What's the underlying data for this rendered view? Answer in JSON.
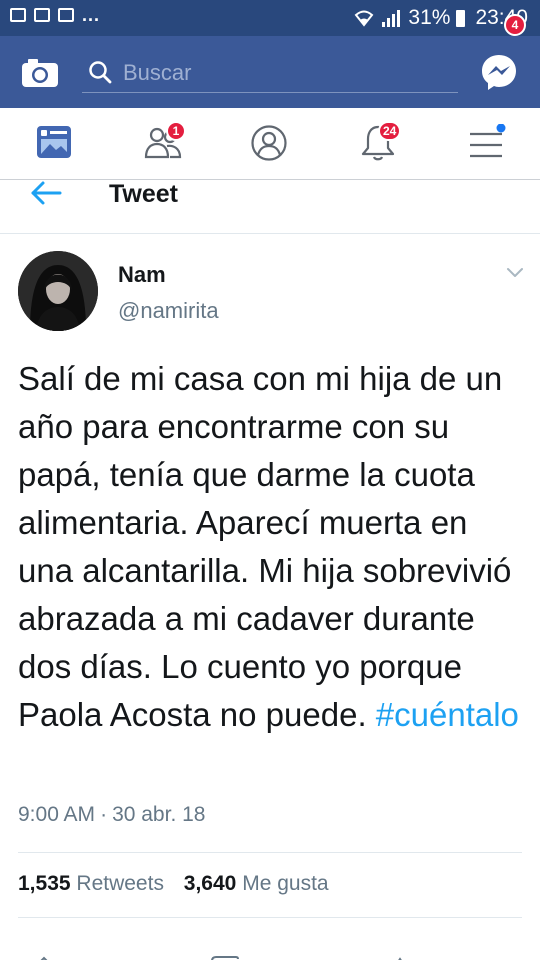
{
  "status_bar": {
    "notification_dots": "...",
    "battery": "31%",
    "time": "23:40"
  },
  "fb_bar": {
    "search_placeholder": "Buscar",
    "messenger_badge": "4"
  },
  "tabs": {
    "friend_requests_badge": "1",
    "notifications_badge": "24"
  },
  "tweet_header": {
    "title": "Tweet"
  },
  "tweet": {
    "author_name": "Nam",
    "author_handle": "@namirita",
    "text": "Salí de mi casa con mi hija de un año para encontrarme con su papá, tenía que darme la cuota alimentaria. Aparecí muerta en una alcantarilla. Mi hija sobrevivió abrazada a mi cadaver durante dos días. Lo cuento yo porque Paola Acosta no puede. ",
    "hashtag": "#cuéntalo",
    "time": "9:00 AM",
    "separator": "·",
    "date": "30 abr. 18",
    "retweets_count": "1,535",
    "retweets_label": "Retweets",
    "likes_count": "3,640",
    "likes_label": "Me gusta"
  },
  "colors": {
    "fb_blue": "#3b5998",
    "status_blue": "#29487d",
    "twitter_blue": "#1da1f2",
    "badge_red": "#e41e3f",
    "secondary_text": "#657786"
  }
}
